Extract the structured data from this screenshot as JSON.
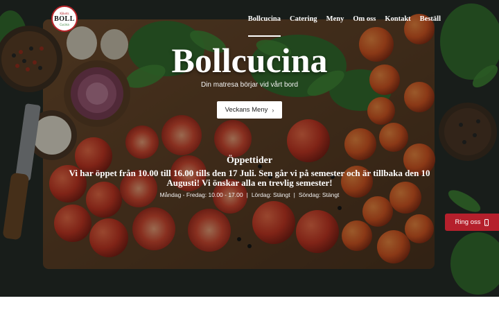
{
  "brand": {
    "logo_top": "Kökets",
    "logo_main": "BOLL",
    "logo_bottom": "Cucina"
  },
  "nav": {
    "items": [
      {
        "label": "Bollcucina",
        "active": true
      },
      {
        "label": "Catering",
        "active": false
      },
      {
        "label": "Meny",
        "active": false
      },
      {
        "label": "Om oss",
        "active": false
      },
      {
        "label": "Kontakt",
        "active": false
      },
      {
        "label": "Beställ",
        "active": false
      }
    ]
  },
  "hero": {
    "title": "Bollcucina",
    "tagline": "Din matresa börjar vid vårt bord",
    "cta_label": "Veckans Meny",
    "cta_icon": "chevron-right-icon"
  },
  "hours": {
    "title": "Öppettider",
    "notice": "Vi har öppet från 10.00 till 16.00 tills den 17 Juli. Sen går vi på semester och är tillbaka den 10 Augusti! Vi önskar alla en trevlig semester!",
    "weekdays": "Måndag - Fredag: 10.00 - 17.00",
    "saturday": "Lördag: Stängt",
    "sunday": "Söndag: Stängt",
    "separator": "|"
  },
  "call_button": {
    "label": "Ring oss",
    "icon": "phone-icon"
  },
  "colors": {
    "accent": "#b5202c",
    "text": "#ffffff"
  }
}
